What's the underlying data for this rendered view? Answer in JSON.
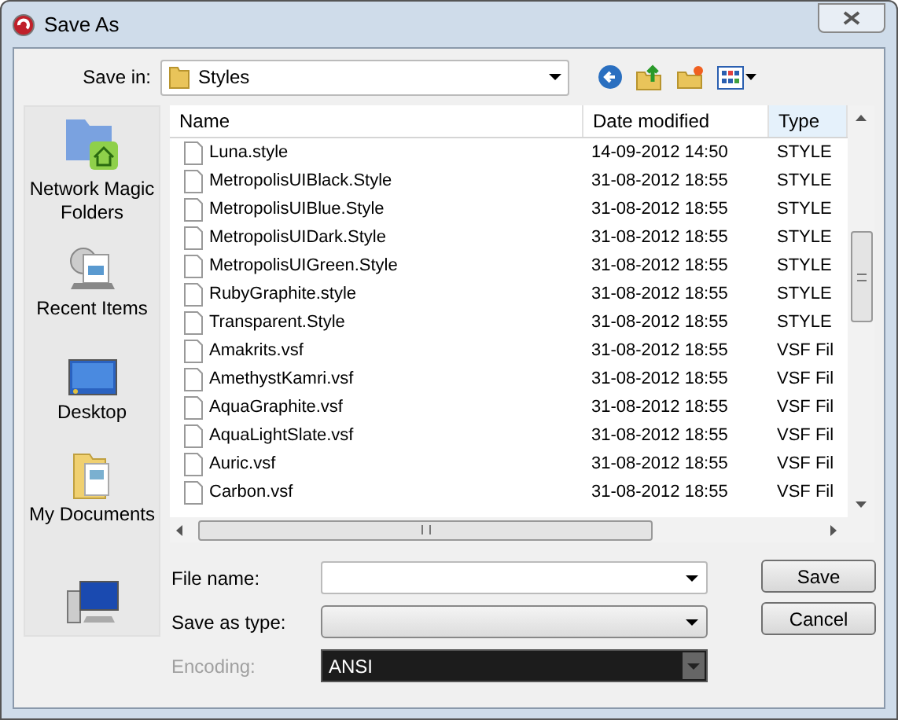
{
  "window": {
    "title": "Save As"
  },
  "save_in": {
    "label": "Save in:",
    "value": "Styles"
  },
  "sidebar": {
    "items": [
      {
        "kind": "network",
        "label": "Network Magic Folders"
      },
      {
        "kind": "recent",
        "label": "Recent Items"
      },
      {
        "kind": "desktop",
        "label": "Desktop"
      },
      {
        "kind": "documents",
        "label": "My Documents"
      },
      {
        "kind": "computer"
      }
    ]
  },
  "file_list": {
    "columns": [
      "Name",
      "Date modified",
      "Type"
    ],
    "rows": [
      [
        "Luna.style",
        "14-09-2012 14:50",
        "STYLE"
      ],
      [
        "MetropolisUIBlack.Style",
        "31-08-2012 18:55",
        "STYLE"
      ],
      [
        "MetropolisUIBlue.Style",
        "31-08-2012 18:55",
        "STYLE"
      ],
      [
        "MetropolisUIDark.Style",
        "31-08-2012 18:55",
        "STYLE"
      ],
      [
        "MetropolisUIGreen.Style",
        "31-08-2012 18:55",
        "STYLE"
      ],
      [
        "RubyGraphite.style",
        "31-08-2012 18:55",
        "STYLE"
      ],
      [
        "Transparent.Style",
        "31-08-2012 18:55",
        "STYLE"
      ],
      [
        "Amakrits.vsf",
        "31-08-2012 18:55",
        "VSF Fil"
      ],
      [
        "AmethystKamri.vsf",
        "31-08-2012 18:55",
        "VSF Fil"
      ],
      [
        "AquaGraphite.vsf",
        "31-08-2012 18:55",
        "VSF Fil"
      ],
      [
        "AquaLightSlate.vsf",
        "31-08-2012 18:55",
        "VSF Fil"
      ],
      [
        "Auric.vsf",
        "31-08-2012 18:55",
        "VSF Fil"
      ],
      [
        "Carbon.vsf",
        "31-08-2012 18:55",
        "VSF Fil"
      ]
    ]
  },
  "fields": [
    {
      "kind": "text",
      "label": "File name:",
      "disabled": false
    },
    {
      "kind": "combo",
      "label": "Save as type:",
      "disabled": false
    },
    {
      "kind": "dark",
      "label": "Encoding:",
      "value": "ANSI",
      "disabled": true
    }
  ],
  "buttons": [
    "Save",
    "Cancel"
  ]
}
